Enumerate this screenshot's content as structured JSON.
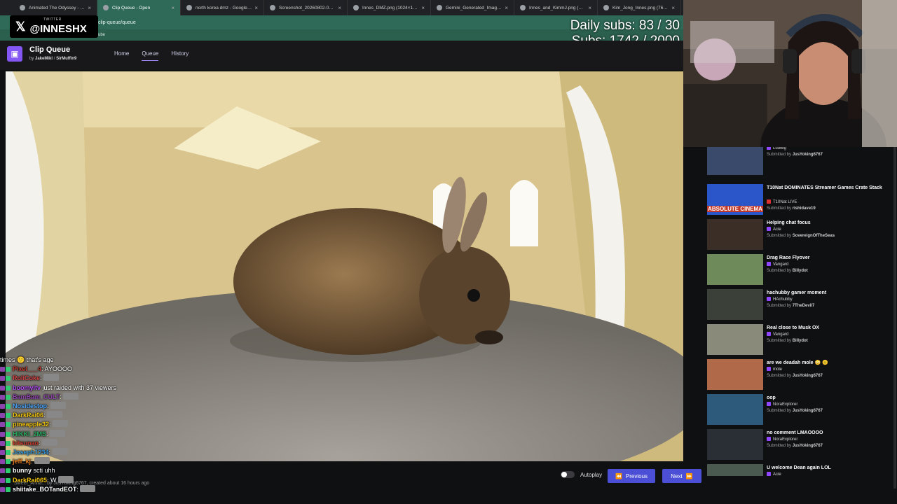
{
  "browser": {
    "tabs": [
      {
        "title": "Animated The Odyssey - Goog",
        "active": false
      },
      {
        "title": "Clip Queue - Open",
        "active": true
      },
      {
        "title": "north korea dmz - Google Sea",
        "active": false
      },
      {
        "title": "Screenshot_20260802-071502.p",
        "active": false
      },
      {
        "title": "Innes_DMZ.png (1024×1040)",
        "active": false
      },
      {
        "title": "Gemini_Generated_Image_xz9r",
        "active": false
      },
      {
        "title": "Innes_and_KimmJ.png (1462×1",
        "active": false
      },
      {
        "title": "Kim_Jong_Innes.png (768×136",
        "active": false
      }
    ],
    "url": "clip-queue/queue",
    "bookmarks_text": "ube"
  },
  "overlay": {
    "twitter_label": "TWITTER",
    "twitter_handle": "@INNESHX",
    "daily_subs": "Daily subs: 83 / 30",
    "subs": "Subs: 1742 / 2000"
  },
  "app": {
    "title": "Clip Queue",
    "by": "by",
    "author1": "JakeMiki",
    "separator": "/",
    "author2": "SirMuffin9",
    "nav": [
      "Home",
      "Queue",
      "History"
    ],
    "active_nav": "Queue"
  },
  "player": {
    "meta": "Sweet_Anita... by JusYoking6767, created about 16 hours ago",
    "autoplay_label": "Autoplay",
    "previous_label": "Previous",
    "next_label": "Next"
  },
  "queue": [
    {
      "title": "",
      "channel": "Ludwig",
      "submitter": "JusYoking6767",
      "thumb": "#3a4a6a"
    },
    {
      "title": "T10Nat DOMINATES Streamer Games Crate Stack",
      "channel": "T10Nat LIVE",
      "submitter": "rishidave19",
      "thumb": "#2b56c9",
      "thumb_text": "ABSOLUTE CINEMA",
      "live": true
    },
    {
      "title": "Helping chat focus",
      "channel": "Acie",
      "submitter": "SovereignOfTheSeas",
      "thumb": "#3a2e26"
    },
    {
      "title": "Drag Race Flyover",
      "channel": "Vangard",
      "submitter": "Billydot",
      "thumb": "#6f8a5a"
    },
    {
      "title": "hachubby gamer moment",
      "channel": "HAchubby",
      "submitter": "7TheDevil7",
      "thumb": "#3b4038"
    },
    {
      "title": "Real close to Musk OX",
      "channel": "Vangard",
      "submitter": "Billydot",
      "thumb": "#8a8a7a"
    },
    {
      "title": "are we deadah mole",
      "title_suffix": "😳 😐",
      "channel": "mole",
      "submitter": "JusYoking6767",
      "thumb": "#b06a4a"
    },
    {
      "title": "oop",
      "channel": "NoraExplorer",
      "submitter": "JusYoking6767",
      "thumb": "#2d5a7a"
    },
    {
      "title": "no comment LMAOOOO",
      "channel": "NoraExplorer",
      "submitter": "JusYoking6767",
      "thumb": "#2a2f36"
    },
    {
      "title": "U welcome Dean again LOL",
      "channel": "Acie",
      "submitter": "JusYoking6767",
      "thumb": "#4a5a50"
    }
  ],
  "queue_submitted_prefix": "Submitted by",
  "chat": [
    {
      "user": "",
      "message": "times 🙂 that's age",
      "color": "#ffffff"
    },
    {
      "user": "Pixel___4",
      "message": ": AYOOOO",
      "color": "#c0392b"
    },
    {
      "user": "RoliCoke",
      "message": ":",
      "color": "#d64545",
      "emote": true
    },
    {
      "user": "boomyitv",
      "message": " just raided with 37 viewers",
      "color": "#b24bf3",
      "raid": true
    },
    {
      "user": "BamBam_CULT",
      "message": ":",
      "color": "#8e44ad",
      "emote": true
    },
    {
      "user": "Nosidestop",
      "message": ":",
      "color": "#4ea8ff",
      "emote": true
    },
    {
      "user": "DarkRai06",
      "message": ":",
      "color": "#f1c40f",
      "emote": true
    },
    {
      "user": "pineapple32",
      "message": ":",
      "color": "#f1c40f",
      "emote": true
    },
    {
      "user": "HIKKI_2MS",
      "message": ":",
      "color": "#27ae60",
      "emote": true
    },
    {
      "user": "kitsunao",
      "message": ":",
      "color": "#c0392b",
      "emote": true
    },
    {
      "user": "Joseph1234",
      "message": ":",
      "color": "#3498db",
      "emote": true
    },
    {
      "user": "jeff_kj",
      "message": ":",
      "color": "#e67e22",
      "emote": true
    },
    {
      "user": "bunny",
      "message": " scti uhh",
      "color": "#ffffff"
    },
    {
      "user": "DarkRai065",
      "message": ": W",
      "color": "#f1c40f",
      "emote": true
    },
    {
      "user": "shiitake_BOTandEOT",
      "message": ":",
      "color": "#ffffff",
      "emote": true
    }
  ]
}
